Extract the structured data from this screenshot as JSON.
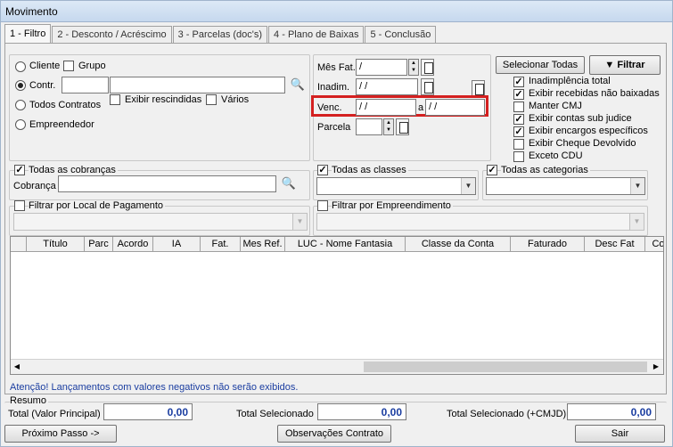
{
  "window": {
    "title": "Movimento"
  },
  "tabs": [
    "1 - Filtro",
    "2 - Desconto / Acréscimo",
    "3 - Parcelas (doc's)",
    "4 - Plano de Baixas",
    "5 - Conclusão"
  ],
  "filter": {
    "cliente": "Cliente",
    "grupo": "Grupo",
    "contr": "Contr.",
    "todos_contratos": "Todos Contratos",
    "empreendedor": "Empreendedor",
    "exibir_rescindidas": "Exibir rescindidas",
    "varios": "Vários"
  },
  "dates": {
    "mes_fat_label": "Mês Fat.",
    "mes_fat_value": " /",
    "inadim_label": "Inadim.",
    "inadim_value": " / /",
    "venc_label": "Venc.",
    "venc_from": " / /",
    "venc_sep": "a",
    "venc_to": " / /",
    "parcela_label": "Parcela"
  },
  "options": {
    "select_all": "Selecionar Todas",
    "filter_button": "Filtrar",
    "items": [
      {
        "label": "Inadimplência total",
        "checked": true
      },
      {
        "label": "Exibir recebidas não baixadas",
        "checked": true
      },
      {
        "label": "Manter CMJ",
        "checked": false
      },
      {
        "label": "Exibir contas sub judice",
        "checked": true
      },
      {
        "label": "Exibir encargos específicos",
        "checked": true
      },
      {
        "label": "Exibir Cheque Devolvido",
        "checked": false
      },
      {
        "label": "Exceto CDU",
        "checked": false
      }
    ]
  },
  "groups": {
    "todas_cobrancas": "Todas as cobranças",
    "cobranca": "Cobrança",
    "todas_classes": "Todas as classes",
    "todas_categorias": "Todas as categorias",
    "filtrar_local": "Filtrar por Local de Pagamento",
    "filtrar_empreendimento": "Filtrar por Empreendimento"
  },
  "grid": {
    "columns": [
      "Título",
      "Parc",
      "Acordo",
      "IA",
      "Fat.",
      "Mes Ref.",
      "LUC - Nome Fantasia",
      "Classe da Conta",
      "Faturado",
      "Desc Fat",
      "Co"
    ]
  },
  "warning": "Atenção! Lançamentos com valores negativos não serão exibidos.",
  "resumo": {
    "title": "Resumo",
    "total_principal_label": "Total (Valor Principal)",
    "total_principal_value": "0,00",
    "total_selecionado_label": "Total Selecionado",
    "total_selecionado_value": "0,00",
    "total_cmjd_label": "Total Selecionado (+CMJD)",
    "total_cmjd_value": "0,00"
  },
  "footer": {
    "next": "Próximo Passo ->",
    "obs": "Observações Contrato",
    "exit": "Sair"
  },
  "colors": {
    "highlight": "#d42020",
    "value_text": "#1a3da0"
  }
}
